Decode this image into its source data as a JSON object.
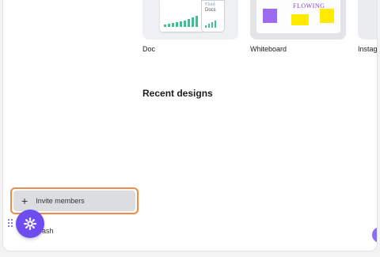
{
  "templates": [
    {
      "label": "Doc"
    },
    {
      "label": "Whiteboard"
    },
    {
      "label": "Instag"
    }
  ],
  "doc_thumbnail": {
    "title_line1": "Fluid",
    "title_line2": "Docs"
  },
  "whiteboard_thumbnail": {
    "title": "FLOWING"
  },
  "recent": {
    "title": "Recent designs"
  },
  "sidebar": {
    "invite_label": "Invite members",
    "trash_label": "rash"
  },
  "colors": {
    "accent_purple": "#6d4cf0",
    "highlight_orange": "#f08a4b",
    "chart_green": "#39c394"
  },
  "icons": [
    "plus-icon",
    "gear-icon",
    "drag-handle-icon"
  ]
}
